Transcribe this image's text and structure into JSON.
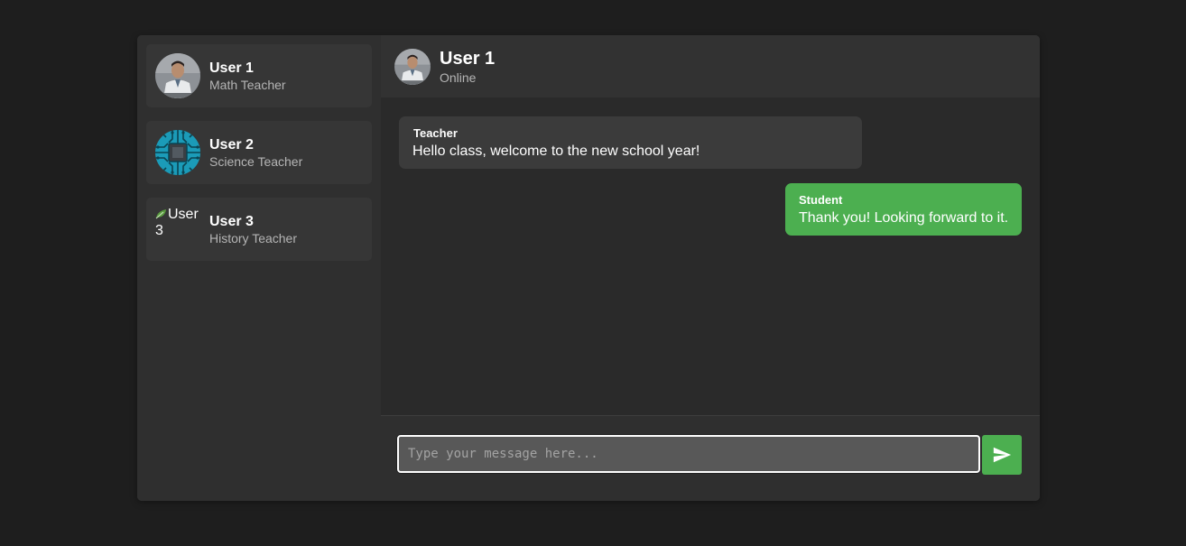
{
  "sidebar": {
    "contacts": [
      {
        "name": "User 1",
        "role": "Math Teacher",
        "avatar": "teacher-photo"
      },
      {
        "name": "User 2",
        "role": "Science Teacher",
        "avatar": "circuit-chip"
      },
      {
        "name": "User 3",
        "role": "History Teacher",
        "avatar_alt": "User 3"
      }
    ]
  },
  "header": {
    "name": "User 1",
    "status": "Online"
  },
  "messages": [
    {
      "sender": "Teacher",
      "text": "Hello class, welcome to the new school year!"
    },
    {
      "sender": "Student",
      "text": "Thank you! Looking forward to it."
    }
  ],
  "composer": {
    "placeholder": "Type your message here...",
    "value": "",
    "send_icon": "send-icon"
  },
  "colors": {
    "accent": "#4caf50",
    "page_bg": "#1e1e1e",
    "panel_bg": "#2f2f2f",
    "messages_bg": "#2a2a2a",
    "bubble_incoming": "#3b3b3b"
  }
}
